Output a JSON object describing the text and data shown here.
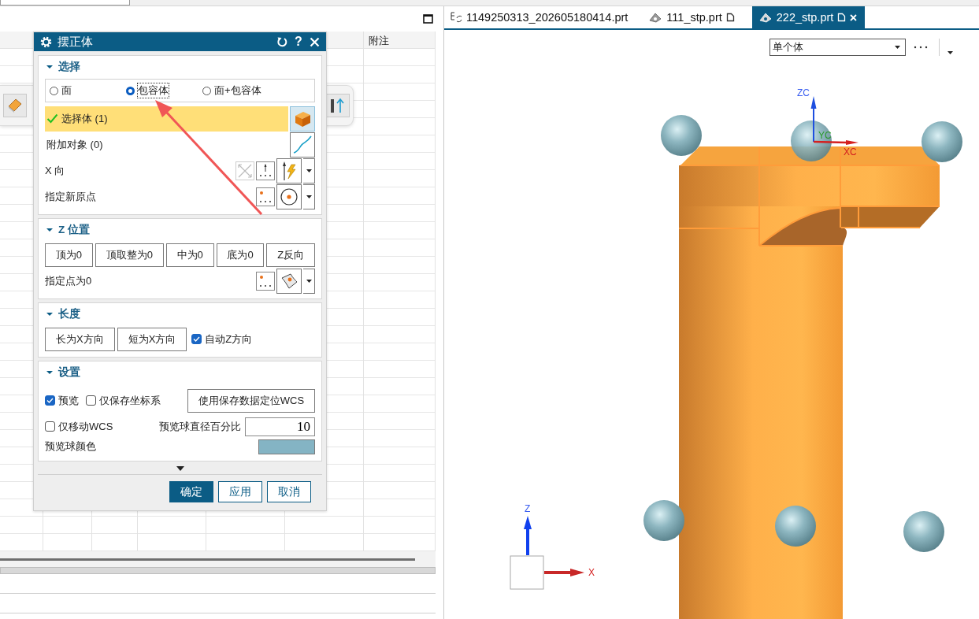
{
  "left_pane": {
    "table": {
      "columns": [
        "附注"
      ]
    }
  },
  "dialog": {
    "title": "摆正体",
    "help": "?",
    "sections": [
      {
        "title": "选择",
        "expanded": true,
        "items": [
          {
            "kind": "radio_group",
            "options": [
              {
                "label": "面",
                "selected": false
              },
              {
                "label": "包容体",
                "selected": true
              },
              {
                "label": "面+包容体",
                "selected": false
              }
            ]
          },
          {
            "kind": "body_selector",
            "label": "选择体 (1)",
            "done": true,
            "active": true
          },
          {
            "kind": "curve_selector",
            "label": "附加对象 (0)",
            "done": false,
            "active": false
          },
          {
            "kind": "vector",
            "label": "X 向"
          },
          {
            "kind": "circle_point",
            "label": "指定新原点"
          }
        ]
      },
      {
        "title": "Z 位置",
        "expanded": true,
        "items": [
          {
            "kind": "button_row",
            "buttons": [
              "顶为0",
              "顶取整为0",
              "中为0",
              "底为0",
              "Z反向"
            ]
          },
          {
            "kind": "surface_point",
            "label": "指定点为0"
          }
        ]
      },
      {
        "title": "长度",
        "expanded": true,
        "items": [
          {
            "kind": "button_row",
            "buttons": [
              "长为X方向",
              "短为X方向"
            ],
            "checks": [
              {
                "label": "自动Z方向",
                "checked": true
              }
            ]
          }
        ]
      },
      {
        "title": "设置",
        "expanded": true,
        "items": [
          {
            "kind": "check_row",
            "checks": [
              {
                "label": "预览",
                "checked": true
              },
              {
                "label": "仅保存坐标系",
                "checked": false
              }
            ],
            "button": "使用保存数据定位WCS"
          },
          {
            "kind": "check_field_row",
            "checks": [
              {
                "label": "仅移动WCS",
                "checked": false
              }
            ],
            "field_label": "预览球直径百分比",
            "value": "10"
          },
          {
            "kind": "color_row",
            "label": "预览球颜色",
            "color": "#84b4c4"
          }
        ]
      }
    ],
    "buttons": [
      {
        "label": "确定",
        "primary": true
      },
      {
        "label": "应用",
        "primary": false
      },
      {
        "label": "取消",
        "primary": false
      }
    ]
  },
  "tabs": [
    {
      "label": "1149250313_202605180414.prt",
      "kind": "assembly",
      "selected": false,
      "modified": false
    },
    {
      "label": "111_stp.prt",
      "kind": "part",
      "selected": false,
      "modified": true
    },
    {
      "label": "222_stp.prt",
      "kind": "part",
      "selected": true,
      "modified": true
    }
  ],
  "viewport": {
    "filter": {
      "value": "单个体"
    },
    "wcs": {
      "z": "ZC",
      "y": "YC",
      "x": "XC"
    },
    "view_triad": {
      "z": "Z",
      "x": "X"
    }
  }
}
